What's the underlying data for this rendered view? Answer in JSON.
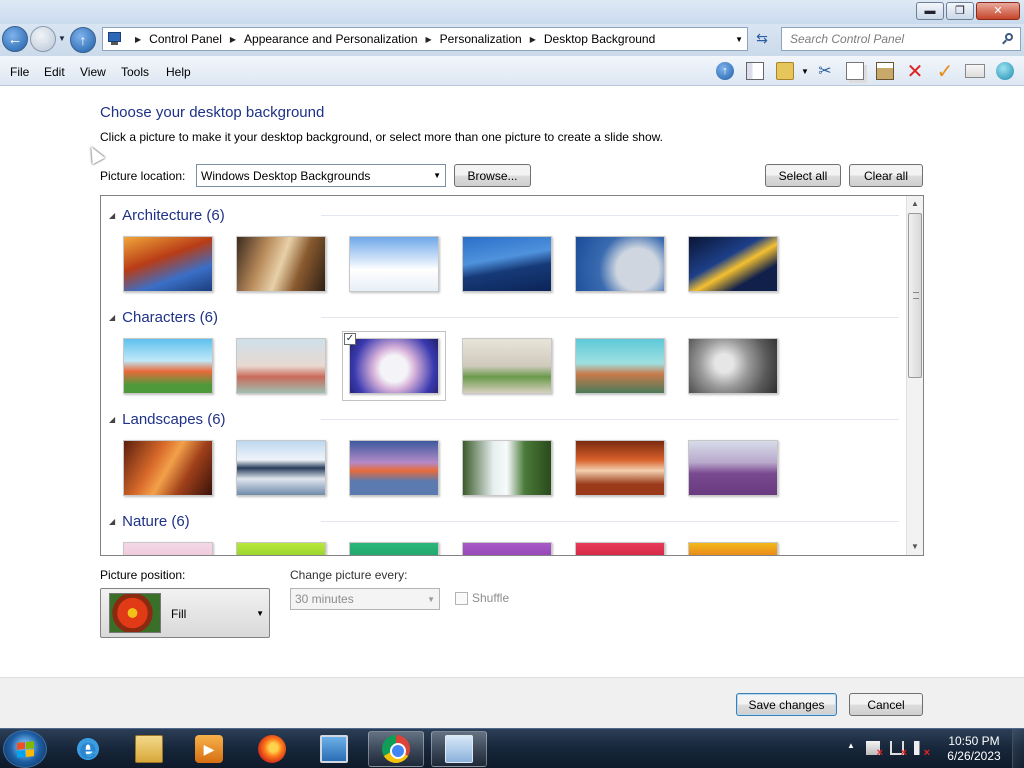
{
  "window": {
    "minimize_glyph": "▬",
    "maximize_glyph": "❐",
    "close_glyph": "✕"
  },
  "address_bar": {
    "breadcrumbs": [
      "Control Panel",
      "Appearance and Personalization",
      "Personalization",
      "Desktop Background"
    ],
    "search_placeholder": "Search Control Panel"
  },
  "menu": [
    "File",
    "Edit",
    "View",
    "Tools",
    "Help"
  ],
  "toolbar_icons": [
    "up-arrow-icon",
    "pane-icon",
    "folder-icon",
    "scissors-icon",
    "copy-icon",
    "paste-icon",
    "delete-icon",
    "check-icon",
    "mail-icon",
    "globe-icon"
  ],
  "content": {
    "title": "Choose your desktop background",
    "subtitle": "Click a picture to make it your desktop background, or select more than one picture to create a slide show.",
    "picture_location_label": "Picture location:",
    "picture_location_value": "Windows Desktop Backgrounds",
    "browse_label": "Browse...",
    "select_all_label": "Select all",
    "clear_all_label": "Clear all"
  },
  "groups": [
    {
      "title": "Architecture (6)",
      "thumbs": [
        "linear-gradient(160deg,#f0a63a 0,#b83c16 40%,#3a6fc7 70%,#1b3d7a)",
        "linear-gradient(110deg,#3a2a1e 0,#b88a5a 30%,#e8d0a8 50%,#8a5a2e 70%,#2e2016)",
        "linear-gradient(#6fa8e8 0,#d8e8fa 45%,#ffffff 60%,#e8eef6)",
        "linear-gradient(170deg,#2a70c8 0,#4f92dd 40%,#163a78 60%,#0c2458)",
        "radial-gradient(circle at 70% 60%,#cfd6e0 0 30%,#3a6bb0 55%,#1a4c98)",
        "linear-gradient(150deg,#0a1636 0,#1d3f88 40%,#f4c030 55%,#10204a 75%)"
      ]
    },
    {
      "title": "Characters (6)",
      "thumbs": [
        "linear-gradient(#5fc0ee 0,#bfe8f8 40%,#e86a3a 60%,#4e9a3a 85%)",
        "linear-gradient(#cfe0ea 0,#e8d8d0 50%,#c96a5a 70%,#9ec0b0)",
        "radial-gradient(circle at 50% 55%,#f4f4f8 0 25%,#d6b0d8 40%,#3a3ab0 75%,#20206a)",
        "linear-gradient(#e8e4d8 0,#cfcabc 50%,#6a9a4a 70%,#d8d0c0)",
        "linear-gradient(#5ec8d8 0,#9fe0e0 45%,#c87a4a 65%,#4a7a5a)",
        "radial-gradient(circle at 40% 45%,#e6e6e6 0 15%,#9a9a9a 40%,#5a5a5a 70%,#2e2e2e)"
      ]
    },
    {
      "title": "Landscapes (6)",
      "thumbs": [
        "linear-gradient(120deg,#5a1e0e 0,#d86a2a 35%,#f3a04a 50%,#a0401a 70%,#3a120a)",
        "linear-gradient(#bcd8f0 0,#f0f4fa 35%,#283c5a 50%,#dfe6ef 70%,#6e8aaa)",
        "linear-gradient(#3c5a9e 0,#b48ac8 40%,#e86a3a 55%,#5a7ab0 75%)",
        "linear-gradient(90deg,#3a5a2a 0,#e8f0f0 35%,#f6fafa 50%,#4a7a3a 70%,#2a4a1a)",
        "linear-gradient(#7a2a10 0,#d8602a 35%,#f3d0b0 55%,#9a3a1a 80%)",
        "linear-gradient(#d8dcea 0,#b8a8cc 40%,#7a4a90 60%,#6a3a80)"
      ]
    },
    {
      "title": "Nature (6)",
      "thumbs": [
        "linear-gradient(#f4d8e6 0,#e8b8d0 60%,#b07090)",
        "linear-gradient(#b8e83a 0,#6fb81e 60%,#3a7a0e)",
        "linear-gradient(#2ab87a 0,#1a8a5a 60%,#0a4a2a)",
        "linear-gradient(#a85ac8 0,#7a2aa0 60%,#3a0a5a)",
        "linear-gradient(#e83a5a 0,#b80e2a 60%,#6a0010)",
        "linear-gradient(#f3b81a 0,#d8401a 60%,#8a100a)"
      ]
    }
  ],
  "bottom": {
    "position_label": "Picture position:",
    "position_value": "Fill",
    "change_label": "Change picture every:",
    "change_value": "30 minutes",
    "shuffle_label": "Shuffle",
    "save_label": "Save changes",
    "cancel_label": "Cancel"
  },
  "taskbar": {
    "time": "10:50 PM",
    "date": "6/26/2023",
    "apps": [
      "internet-explorer-icon",
      "file-explorer-icon",
      "media-center-icon",
      "firefox-icon",
      "remote-desktop-icon",
      "chrome-icon",
      "control-panel-icon"
    ]
  }
}
